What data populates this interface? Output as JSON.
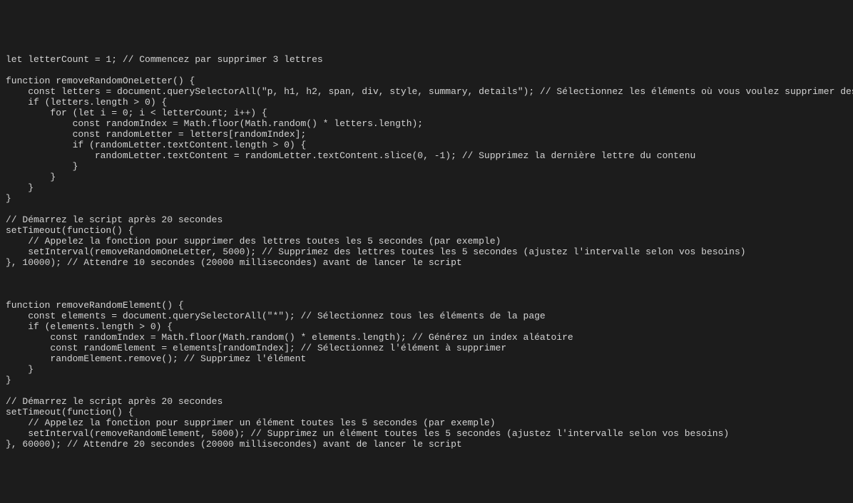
{
  "code_lines": [
    "let letterCount = 1; // Commencez par supprimer 3 lettres",
    "",
    "function removeRandomOneLetter() {",
    "    const letters = document.querySelectorAll(\"p, h1, h2, span, div, style, summary, details\"); // Sélectionnez les éléments où vous voulez supprimer des lettres",
    "    if (letters.length > 0) {",
    "        for (let i = 0; i < letterCount; i++) {",
    "            const randomIndex = Math.floor(Math.random() * letters.length);",
    "            const randomLetter = letters[randomIndex];",
    "            if (randomLetter.textContent.length > 0) {",
    "                randomLetter.textContent = randomLetter.textContent.slice(0, -1); // Supprimez la dernière lettre du contenu",
    "            }",
    "        }",
    "    }",
    "}",
    "",
    "// Démarrez le script après 20 secondes",
    "setTimeout(function() {",
    "    // Appelez la fonction pour supprimer des lettres toutes les 5 secondes (par exemple)",
    "    setInterval(removeRandomOneLetter, 5000); // Supprimez des lettres toutes les 5 secondes (ajustez l'intervalle selon vos besoins)",
    "}, 10000); // Attendre 10 secondes (20000 millisecondes) avant de lancer le script",
    "",
    "",
    "",
    "function removeRandomElement() {",
    "    const elements = document.querySelectorAll(\"*\"); // Sélectionnez tous les éléments de la page",
    "    if (elements.length > 0) {",
    "        const randomIndex = Math.floor(Math.random() * elements.length); // Générez un index aléatoire",
    "        const randomElement = elements[randomIndex]; // Sélectionnez l'élément à supprimer",
    "        randomElement.remove(); // Supprimez l'élément",
    "    }",
    "}",
    "",
    "// Démarrez le script après 20 secondes",
    "setTimeout(function() {",
    "    // Appelez la fonction pour supprimer un élément toutes les 5 secondes (par exemple)",
    "    setInterval(removeRandomElement, 5000); // Supprimez un élément toutes les 5 secondes (ajustez l'intervalle selon vos besoins)",
    "}, 60000); // Attendre 20 secondes (20000 millisecondes) avant de lancer le script"
  ]
}
